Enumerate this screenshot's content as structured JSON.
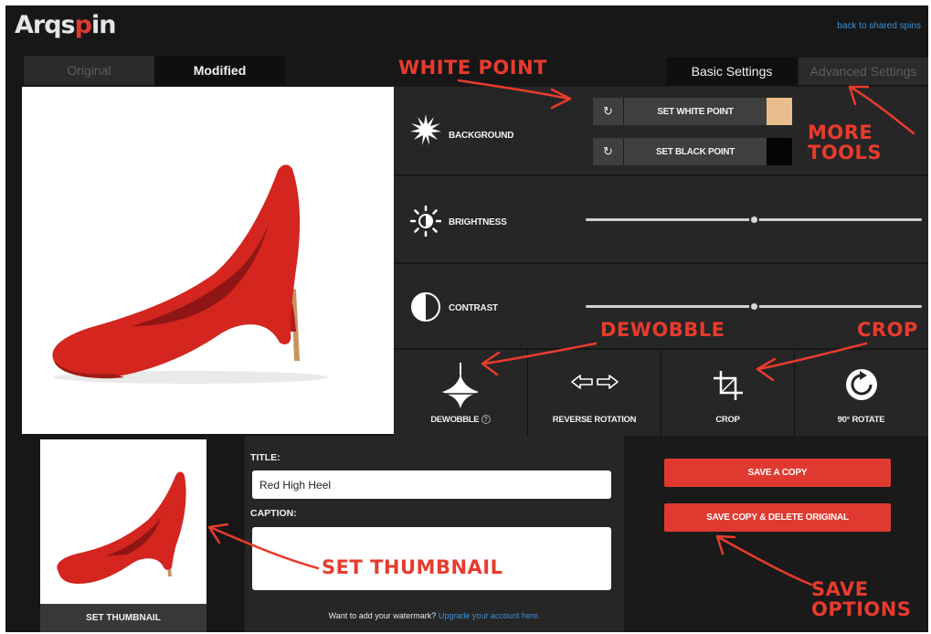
{
  "app": {
    "logo_pre": "Arqs",
    "logo_accent": "p",
    "logo_post": "in",
    "back_link": "back to shared spins"
  },
  "view_tabs": {
    "original": "Original",
    "modified": "Modified"
  },
  "settings_tabs": {
    "basic": "Basic Settings",
    "advanced": "Advanced Settings"
  },
  "background": {
    "label": "BACKGROUND",
    "reset_icon": "↻",
    "white_point_label": "SET WHITE POINT",
    "white_point_color": "#e9bd8c",
    "black_point_label": "SET BLACK POINT",
    "black_point_color": "#050505"
  },
  "brightness": {
    "label": "BRIGHTNESS",
    "value": 0.5
  },
  "contrast": {
    "label": "CONTRAST",
    "value": 0.5
  },
  "tools": [
    {
      "label": "DEWOBBLE",
      "icon": "spinning-top-icon",
      "has_help": true
    },
    {
      "label": "REVERSE ROTATION",
      "icon": "reverse-arrows-icon"
    },
    {
      "label": "CROP",
      "icon": "crop-icon"
    },
    {
      "label": "90° ROTATE",
      "icon": "rotate-icon"
    }
  ],
  "thumbnail": {
    "button": "SET THUMBNAIL"
  },
  "form": {
    "title_label": "TITLE:",
    "title_value": "Red High Heel",
    "caption_label": "CAPTION:",
    "caption_value": "",
    "watermark_text": "Want to add your watermark?",
    "watermark_link": "Upgrade your account here."
  },
  "save": {
    "copy": "SAVE A COPY",
    "copy_delete": "SAVE COPY & DELETE ORIGINAL"
  },
  "annotations": {
    "white_point": "WHITE POINT",
    "more_tools_1": "MORE",
    "more_tools_2": "TOOLS",
    "dewobble": "DEWOBBLE",
    "crop": "CROP",
    "set_thumbnail": "SET THUMBNAIL",
    "save_options_1": "SAVE",
    "save_options_2": "OPTIONS",
    "color": "#e83b2d"
  },
  "colors": {
    "accent": "#e03a30",
    "link": "#3d8fd9",
    "shoe": "#d4251f"
  }
}
